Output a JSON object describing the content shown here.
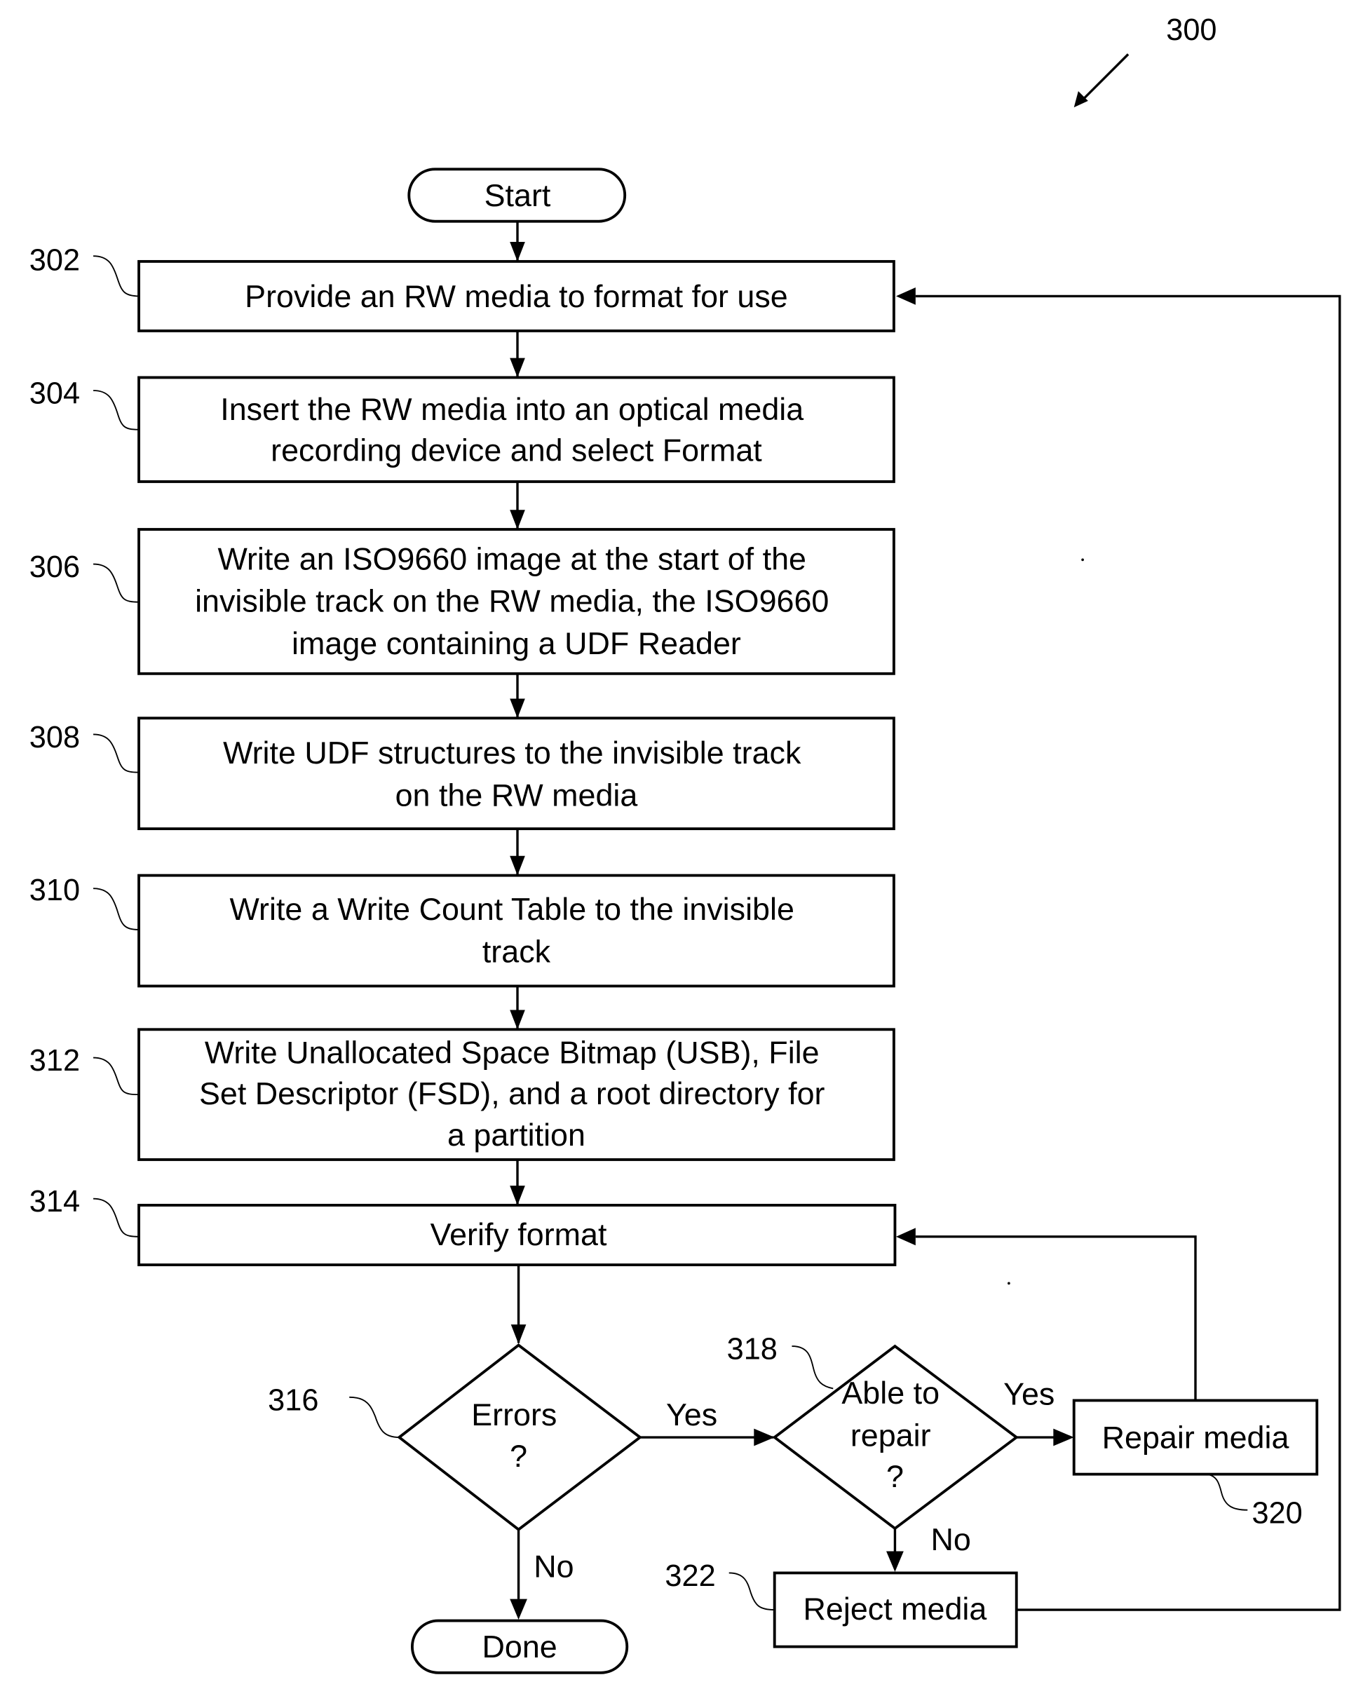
{
  "figure": {
    "ref": "300"
  },
  "terminals": {
    "start": "Start",
    "done": "Done"
  },
  "steps": [
    {
      "ref": "302",
      "lines": [
        "Provide an RW media to format for use"
      ]
    },
    {
      "ref": "304",
      "lines": [
        "Insert the RW media into an optical media",
        "recording device and select Format"
      ]
    },
    {
      "ref": "306",
      "lines": [
        "Write an ISO9660 image at the start of the",
        "invisible track on the RW media, the ISO9660",
        "image containing a UDF Reader"
      ]
    },
    {
      "ref": "308",
      "lines": [
        "Write UDF structures to the invisible track",
        "on the RW media"
      ]
    },
    {
      "ref": "310",
      "lines": [
        "Write a Write Count Table to the invisible",
        "track"
      ]
    },
    {
      "ref": "312",
      "lines": [
        "Write Unallocated Space Bitmap (USB), File",
        "Set Descriptor (FSD), and a root directory for",
        "a partition"
      ]
    },
    {
      "ref": "314",
      "lines": [
        "Verify format"
      ]
    }
  ],
  "decisions": {
    "errors": {
      "ref": "316",
      "lines": [
        "Errors",
        "?"
      ]
    },
    "repair": {
      "ref": "318",
      "lines": [
        "Able to",
        "repair",
        "?"
      ]
    }
  },
  "actions": {
    "repair_media": {
      "ref": "320",
      "label": "Repair media"
    },
    "reject_media": {
      "ref": "322",
      "label": "Reject media"
    }
  },
  "edge_labels": {
    "errors_yes": "Yes",
    "errors_no": "No",
    "repair_yes": "Yes",
    "repair_no": "No"
  }
}
